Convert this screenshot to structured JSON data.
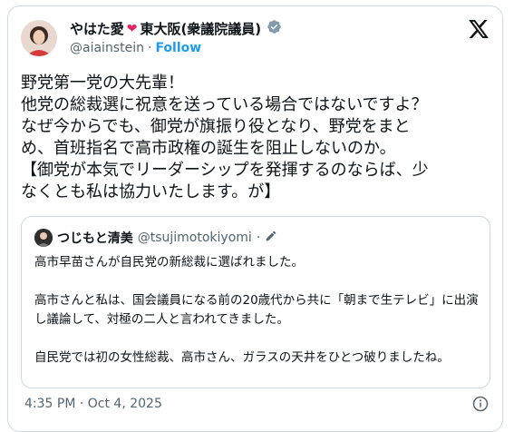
{
  "author": {
    "name": "やはた愛",
    "name_suffix": "東大阪(衆議院議員)",
    "handle": "@aiainstein",
    "separator": "·",
    "follow_label": "Follow"
  },
  "tweet": {
    "lines": [
      "野党第一党の大先輩！",
      "他党の総裁選に祝意を送っている場合ではないですよ？",
      "なぜ今からでも、御党が旗振り役となり、野党をまと",
      "め、首班指名で高市政権の誕生を阻止しないのか。",
      "【御党が本気でリーダーシップを発揮するのならば、少",
      "なくとも私は協力いたします。が】"
    ]
  },
  "quote": {
    "name": "つじもと清美",
    "handle": "@tsujimotokiyomi",
    "separator": "·",
    "paragraphs": [
      "高市早苗さんが自民党の新総裁に選ばれました。",
      "高市さんと私は、国会議員になる前の20歳代から共に「朝まで生テレビ」に出演し議論して、対極の二人と言われてきました。",
      "自民党では初の女性総裁、高市さん、ガラスの天井をひとつ破りましたね。"
    ]
  },
  "meta": {
    "timestamp": "4:35 PM · Oct 4, 2025"
  },
  "colors": {
    "link": "#1d9bf0",
    "verified": "#829aab",
    "heart": "#e0245e",
    "secondary_text": "#536471",
    "border": "#cfd9de"
  },
  "icons": [
    "heart-icon",
    "verified-badge-icon",
    "x-logo-icon",
    "edit-icon",
    "info-icon"
  ]
}
